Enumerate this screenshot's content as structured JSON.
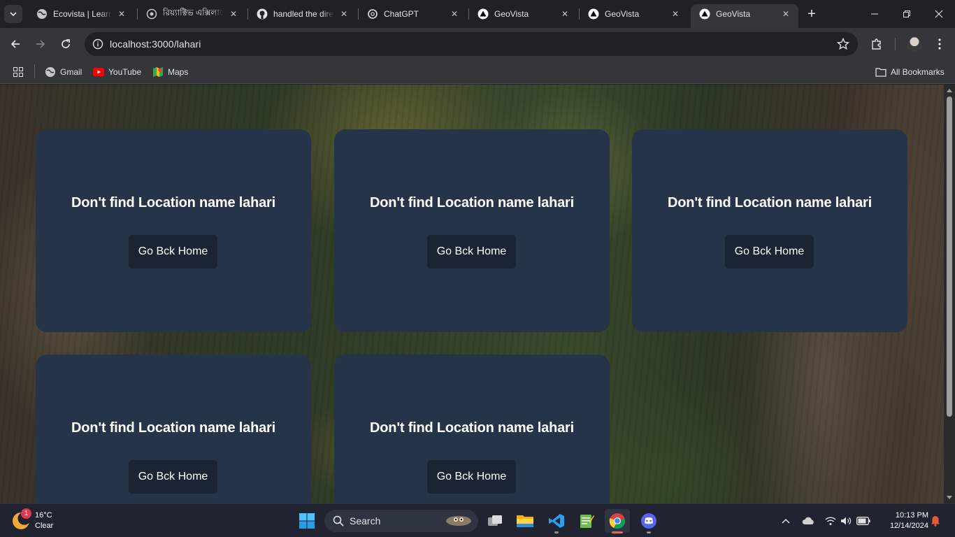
{
  "tabs": [
    {
      "title": "Ecovista | Learn V",
      "favicon": "globe-icon"
    },
    {
      "title": "রিয়্যাক্টিভ এক্সিলারেটর",
      "favicon": "app-icon"
    },
    {
      "title": "handled the direct",
      "favicon": "github-icon"
    },
    {
      "title": "ChatGPT",
      "favicon": "chatgpt-icon"
    },
    {
      "title": "GeoVista",
      "favicon": "triangle-icon"
    },
    {
      "title": "GeoVista",
      "favicon": "triangle-icon"
    },
    {
      "title": "GeoVista",
      "favicon": "triangle-icon",
      "active": true
    }
  ],
  "address_bar": {
    "url": "localhost:3000/lahari"
  },
  "bookmarks": {
    "items": [
      {
        "label": "Gmail",
        "icon": "globe-icon"
      },
      {
        "label": "YouTube",
        "icon": "youtube-icon"
      },
      {
        "label": "Maps",
        "icon": "maps-icon"
      }
    ],
    "all_bookmarks": "All Bookmarks"
  },
  "cards": [
    {
      "message": "Don't find Location name lahari",
      "button": "Go Bck Home"
    },
    {
      "message": "Don't find Location name lahari",
      "button": "Go Bck Home"
    },
    {
      "message": "Don't find Location name lahari",
      "button": "Go Bck Home"
    },
    {
      "message": "Don't find Location name lahari",
      "button": "Go Bck Home"
    },
    {
      "message": "Don't find Location name lahari",
      "button": "Go Bck Home"
    }
  ],
  "taskbar": {
    "weather": {
      "temp": "16°C",
      "condition": "Clear",
      "badge": "1"
    },
    "search_label": "Search",
    "clock": {
      "time": "10:13 PM",
      "date": "12/14/2024"
    }
  },
  "colors": {
    "card_bg": "#263449",
    "button_bg": "#1b2433",
    "browser_dark": "#202124",
    "browser_toolbar": "#35363a"
  }
}
